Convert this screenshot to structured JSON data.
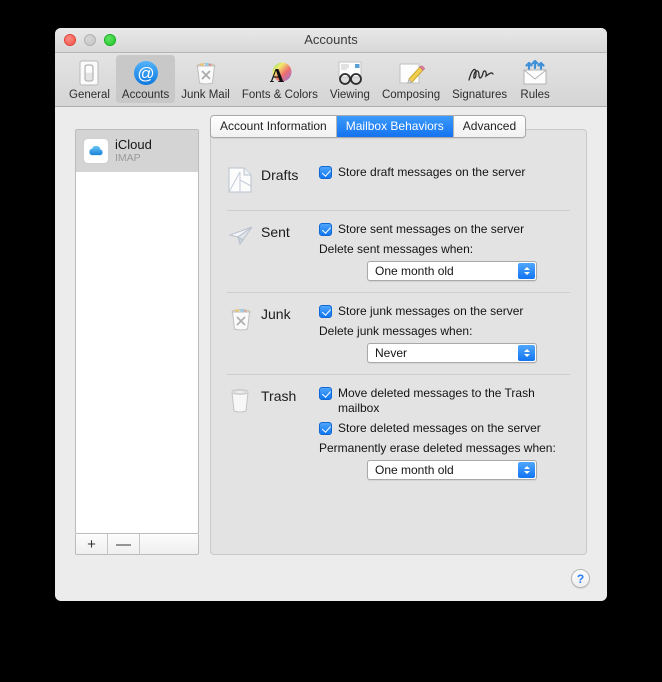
{
  "window": {
    "title": "Accounts"
  },
  "traffic_lights": [
    {
      "name": "close",
      "color": "#f3564c"
    },
    {
      "name": "minimize",
      "color": "#c4c4c4"
    },
    {
      "name": "zoom",
      "color": "#22c82c"
    }
  ],
  "toolbar": {
    "items": [
      {
        "label": "General",
        "icon": "general-switch-icon",
        "selected": false
      },
      {
        "label": "Accounts",
        "icon": "at-sign-icon",
        "selected": true
      },
      {
        "label": "Junk Mail",
        "icon": "junk-trash-icon",
        "selected": false
      },
      {
        "label": "Fonts & Colors",
        "icon": "font-colors-icon",
        "selected": false
      },
      {
        "label": "Viewing",
        "icon": "glasses-icon",
        "selected": false
      },
      {
        "label": "Composing",
        "icon": "pencil-paper-icon",
        "selected": false
      },
      {
        "label": "Signatures",
        "icon": "signature-icon",
        "selected": false
      },
      {
        "label": "Rules",
        "icon": "rules-envelope-icon",
        "selected": false
      }
    ]
  },
  "account_list": {
    "accounts": [
      {
        "name": "iCloud",
        "type": "IMAP",
        "icon": "icloud-icon",
        "selected": true
      }
    ],
    "add_label": "+",
    "remove_label": "—"
  },
  "tabs": [
    {
      "label": "Account Information",
      "selected": false
    },
    {
      "label": "Mailbox Behaviors",
      "selected": true
    },
    {
      "label": "Advanced",
      "selected": false
    }
  ],
  "sections": [
    {
      "title": "Drafts",
      "icon": "drafts-page-icon",
      "checkboxes": [
        {
          "label": "Store draft messages on the server",
          "checked": true
        }
      ]
    },
    {
      "title": "Sent",
      "icon": "sent-plane-icon",
      "checkboxes": [
        {
          "label": "Store sent messages on the server",
          "checked": true
        }
      ],
      "sub_label": "Delete sent messages when:",
      "popup_value": "One month old"
    },
    {
      "title": "Junk",
      "icon": "junk-bin-icon",
      "checkboxes": [
        {
          "label": "Store junk messages on the server",
          "checked": true
        }
      ],
      "sub_label": "Delete junk messages when:",
      "popup_value": "Never"
    },
    {
      "title": "Trash",
      "icon": "trash-bin-icon",
      "checkboxes": [
        {
          "label": "Move deleted messages to the Trash mailbox",
          "checked": true
        },
        {
          "label": "Store deleted messages on the server",
          "checked": true
        }
      ],
      "sub_label": "Permanently erase deleted messages when:",
      "popup_value": "One month old"
    }
  ],
  "help_button": {
    "label": "?"
  },
  "colors": {
    "accent": "#1274f1",
    "selected_tab": "#1372f0",
    "window_bg": "#ececec"
  }
}
